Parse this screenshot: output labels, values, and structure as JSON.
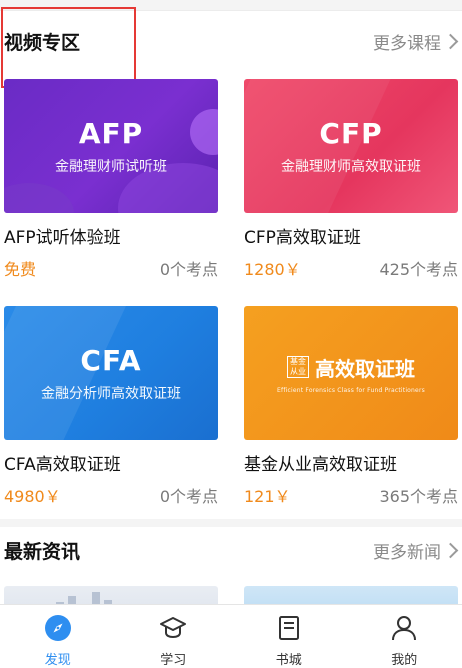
{
  "video_section": {
    "title": "视频专区",
    "more": "更多课程"
  },
  "courses": [
    {
      "thumb_big": "AFP",
      "thumb_sub": "金融理财师试听班",
      "title": "AFP试听体验班",
      "price": "免费",
      "points": "0个考点"
    },
    {
      "thumb_big": "CFP",
      "thumb_sub": "金融理财师高效取证班",
      "title": "CFP高效取证班",
      "price": "1280￥",
      "points": "425个考点"
    },
    {
      "thumb_big": "CFA",
      "thumb_sub": "金融分析师高效取证班",
      "title": "CFA高效取证班",
      "price": "4980￥",
      "points": "0个考点"
    },
    {
      "thumb_seal": "基金从业",
      "thumb_main": "高效取证班",
      "thumb_eng": "Efficient Forensics Class for Fund Practitioners",
      "title": "基金从业高效取证班",
      "price": "121￥",
      "points": "365个考点"
    }
  ],
  "news_section": {
    "title": "最新资讯",
    "more": "更多新闻"
  },
  "tabbar": [
    {
      "label": "发现",
      "icon": "compass-icon",
      "active": true
    },
    {
      "label": "学习",
      "icon": "graduation-cap-icon",
      "active": false
    },
    {
      "label": "书城",
      "icon": "book-icon",
      "active": false
    },
    {
      "label": "我的",
      "icon": "user-icon",
      "active": false
    }
  ],
  "colors": {
    "accent": "#2e8ef0",
    "price": "#f08a1c",
    "highlight_box": "#e53935"
  }
}
